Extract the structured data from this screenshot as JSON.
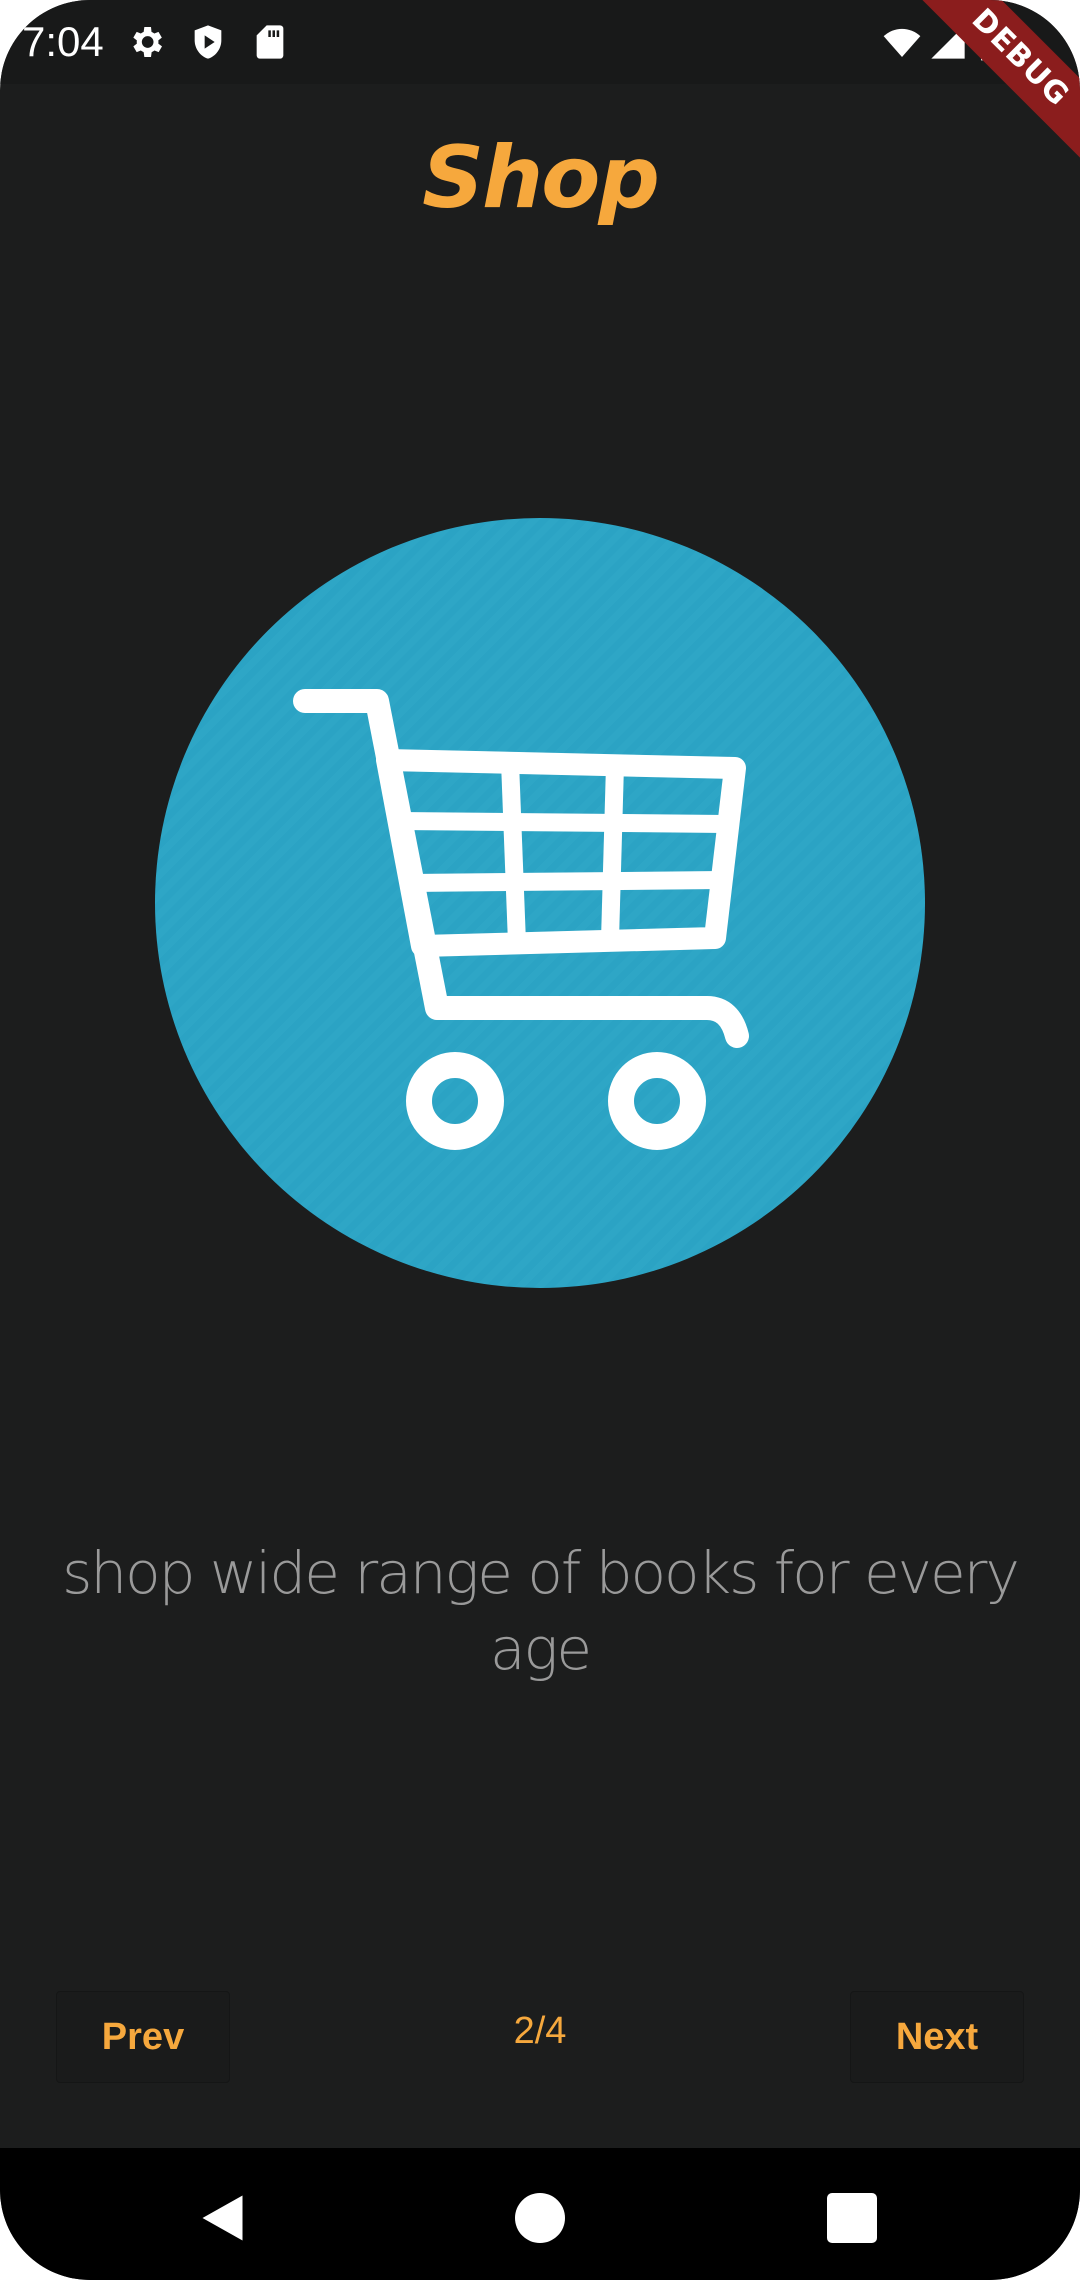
{
  "status_bar": {
    "time": "7:04",
    "icons": [
      "gear-icon",
      "shield-play-icon",
      "sd-card-icon",
      "wifi-icon",
      "cell-signal-icon",
      "battery-icon"
    ],
    "debug_label": "DEBUG"
  },
  "header": {
    "title": "Shop"
  },
  "illustration": {
    "icon": "shopping-cart-icon",
    "circle_color": "#2ba3c4"
  },
  "main": {
    "description": "shop wide range of books for every age"
  },
  "controls": {
    "prev_label": "Prev",
    "next_label": "Next",
    "page_indicator": "2/4"
  },
  "system_nav": {
    "icons": [
      "back-icon",
      "home-icon",
      "recents-icon"
    ]
  },
  "colors": {
    "accent": "#f6a83d",
    "background": "#1c1d1d",
    "text_muted": "#9a9a9a"
  }
}
